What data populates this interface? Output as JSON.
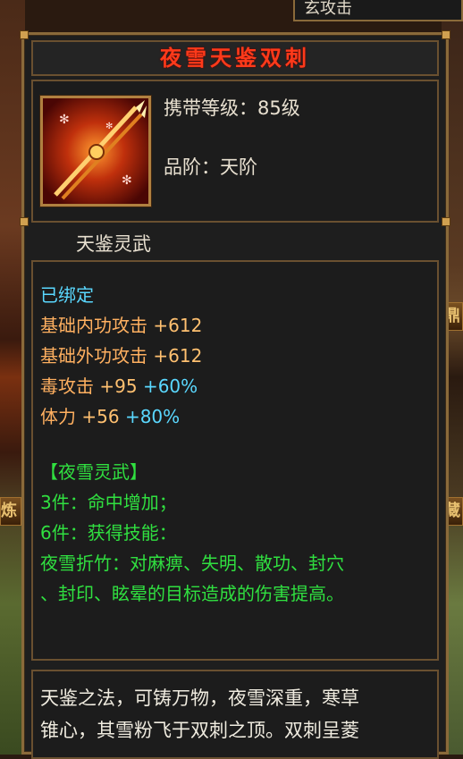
{
  "top_strip": {
    "label": "玄攻击"
  },
  "side_tags": {
    "left_lower": "炼",
    "right_upper": "鼎",
    "right_lower": "藏"
  },
  "item": {
    "name": "夜雪天鉴双刺",
    "level_label": "携带等级：",
    "level_value": "85级",
    "grade_label": "品阶：",
    "grade_value": "天阶",
    "set_label": "天鉴灵武",
    "icon": "twin-spear-icon"
  },
  "stats": {
    "bound": "已绑定",
    "attrs": [
      {
        "name": "基础内功攻击",
        "value": "+612",
        "pct": ""
      },
      {
        "name": "基础外功攻击",
        "value": "+612",
        "pct": ""
      },
      {
        "name": "毒攻击",
        "value": "+95",
        "pct": "+60%"
      },
      {
        "name": "体力",
        "value": "+56",
        "pct": "+80%"
      }
    ],
    "set_title": "【夜雪灵武】",
    "set_bonus_3": "3件：命中增加；",
    "set_bonus_6": "6件：获得技能：",
    "skill_line1": "夜雪折竹：对麻痹、失明、散功、封穴",
    "skill_line2": "、封印、眩晕的目标造成的伤害提高。"
  },
  "description": {
    "line1": "天鉴之法，可铸万物，夜雪深重，寒草",
    "line2": "锥心，其雪粉飞于双刺之顶。双刺呈菱"
  },
  "colors": {
    "title": "#ff3a1a",
    "bound": "#5ad8ff",
    "attr": "#ffb060",
    "set": "#30e040",
    "border": "#8a6a3a"
  }
}
